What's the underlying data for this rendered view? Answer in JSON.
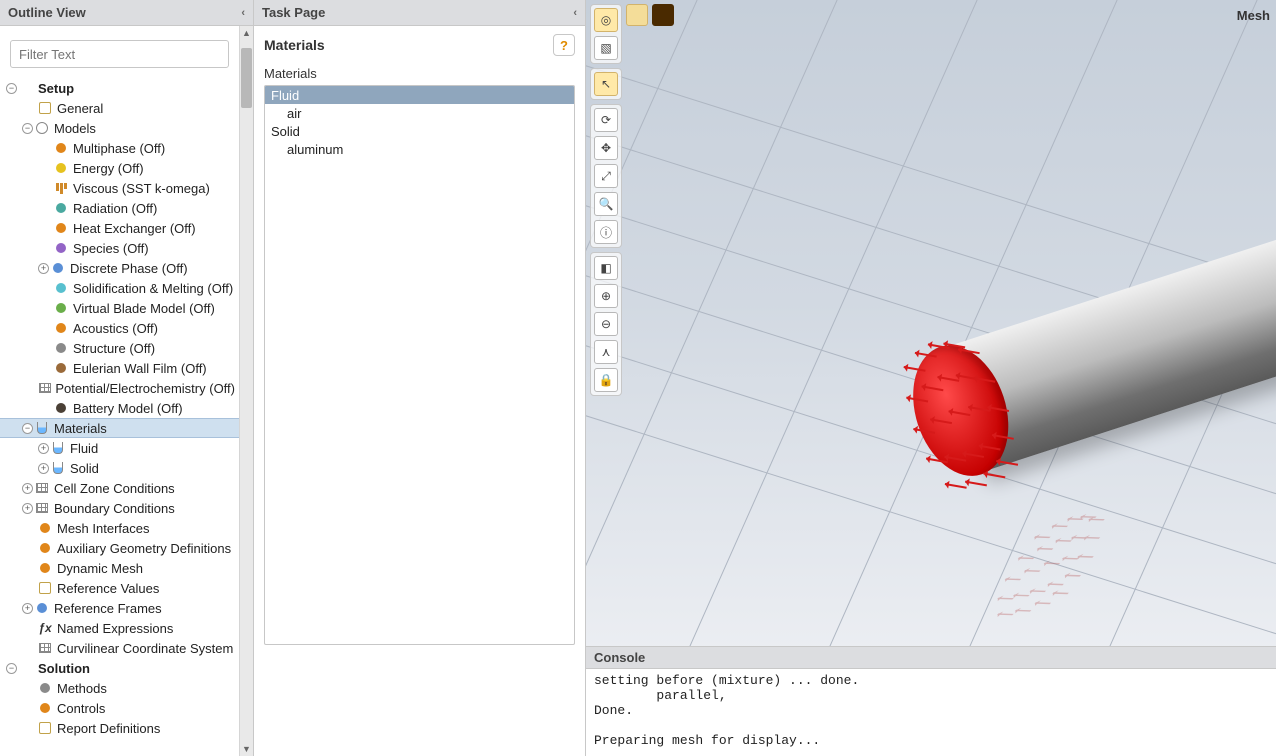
{
  "outline": {
    "title": "Outline View",
    "filter_placeholder": "Filter Text",
    "tree": [
      {
        "label": "Setup",
        "depth": 0,
        "exp": "minus",
        "bold": true,
        "icon": ""
      },
      {
        "label": "General",
        "depth": 1,
        "exp": "none",
        "icon": "sq"
      },
      {
        "label": "Models",
        "depth": 1,
        "exp": "minus",
        "icon": "gear"
      },
      {
        "label": "Multiphase (Off)",
        "depth": 2,
        "exp": "none",
        "icon": "c-orange"
      },
      {
        "label": "Energy (Off)",
        "depth": 2,
        "exp": "none",
        "icon": "c-yellow"
      },
      {
        "label": "Viscous (SST k-omega)",
        "depth": 2,
        "exp": "none",
        "icon": "bars"
      },
      {
        "label": "Radiation (Off)",
        "depth": 2,
        "exp": "none",
        "icon": "c-teal"
      },
      {
        "label": "Heat Exchanger (Off)",
        "depth": 2,
        "exp": "none",
        "icon": "c-orange"
      },
      {
        "label": "Species (Off)",
        "depth": 2,
        "exp": "none",
        "icon": "c-purple"
      },
      {
        "label": "Discrete Phase (Off)",
        "depth": 2,
        "exp": "plus",
        "icon": "c-blue"
      },
      {
        "label": "Solidification & Melting (Off)",
        "depth": 2,
        "exp": "none",
        "icon": "c-cyan"
      },
      {
        "label": "Virtual Blade Model (Off)",
        "depth": 2,
        "exp": "none",
        "icon": "c-green"
      },
      {
        "label": "Acoustics (Off)",
        "depth": 2,
        "exp": "none",
        "icon": "c-orange"
      },
      {
        "label": "Structure (Off)",
        "depth": 2,
        "exp": "none",
        "icon": "c-gray"
      },
      {
        "label": "Eulerian Wall Film (Off)",
        "depth": 2,
        "exp": "none",
        "icon": "c-brown"
      },
      {
        "label": "Potential/Electrochemistry (Off)",
        "depth": 2,
        "exp": "none",
        "icon": "grid"
      },
      {
        "label": "Battery Model (Off)",
        "depth": 2,
        "exp": "none",
        "icon": "c-dark"
      },
      {
        "label": "Materials",
        "depth": 1,
        "exp": "minus",
        "icon": "flask",
        "selected": true
      },
      {
        "label": "Fluid",
        "depth": 2,
        "exp": "plus",
        "icon": "flask"
      },
      {
        "label": "Solid",
        "depth": 2,
        "exp": "plus",
        "icon": "flask"
      },
      {
        "label": "Cell Zone Conditions",
        "depth": 1,
        "exp": "plus",
        "icon": "grid"
      },
      {
        "label": "Boundary Conditions",
        "depth": 1,
        "exp": "plus",
        "icon": "grid"
      },
      {
        "label": "Mesh Interfaces",
        "depth": 1,
        "exp": "none",
        "icon": "c-orange"
      },
      {
        "label": "Auxiliary Geometry Definitions",
        "depth": 1,
        "exp": "none",
        "icon": "c-orange"
      },
      {
        "label": "Dynamic Mesh",
        "depth": 1,
        "exp": "none",
        "icon": "c-orange"
      },
      {
        "label": "Reference Values",
        "depth": 1,
        "exp": "none",
        "icon": "sq"
      },
      {
        "label": "Reference Frames",
        "depth": 1,
        "exp": "plus",
        "icon": "c-blue"
      },
      {
        "label": "Named Expressions",
        "depth": 1,
        "exp": "none",
        "icon": "fx"
      },
      {
        "label": "Curvilinear Coordinate System",
        "depth": 1,
        "exp": "none",
        "icon": "grid"
      },
      {
        "label": "Solution",
        "depth": 0,
        "exp": "minus",
        "bold": true,
        "icon": ""
      },
      {
        "label": "Methods",
        "depth": 1,
        "exp": "none",
        "icon": "c-gray"
      },
      {
        "label": "Controls",
        "depth": 1,
        "exp": "none",
        "icon": "c-orange"
      },
      {
        "label": "Report Definitions",
        "depth": 1,
        "exp": "none",
        "icon": "sq"
      }
    ]
  },
  "taskpage": {
    "title": "Task Page",
    "section_title": "Materials",
    "list_label": "Materials",
    "help": "?",
    "rows": [
      {
        "label": "Fluid",
        "indent": 0,
        "selected": true
      },
      {
        "label": "air",
        "indent": 1
      },
      {
        "label": "Solid",
        "indent": 0
      },
      {
        "label": "aluminum",
        "indent": 1
      }
    ]
  },
  "viewport": {
    "mesh_label": "Mesh",
    "tools": [
      {
        "name": "tool-shaded",
        "glyph": "◎",
        "active": true
      },
      {
        "name": "tool-iso",
        "glyph": "▧"
      },
      {
        "name": "tool-select",
        "glyph": "↖",
        "active": true
      },
      {
        "name": "tool-rotate",
        "glyph": "⟳"
      },
      {
        "name": "tool-pan",
        "glyph": "✥"
      },
      {
        "name": "tool-zoom",
        "glyph": "⤢"
      },
      {
        "name": "tool-zoom-box",
        "glyph": "🔍"
      },
      {
        "name": "tool-info",
        "glyph": "ⓘ"
      },
      {
        "name": "tool-probe",
        "glyph": "◧"
      },
      {
        "name": "tool-zoom-in",
        "glyph": "⊕"
      },
      {
        "name": "tool-zoom-out",
        "glyph": "⊖"
      },
      {
        "name": "tool-axes",
        "glyph": "⋏"
      },
      {
        "name": "tool-lock",
        "glyph": "🔒"
      }
    ]
  },
  "console": {
    "title": "Console",
    "text": "setting before (mixture) ... done.\n        parallel,\nDone.\n\nPreparing mesh for display..."
  },
  "icon_colors": {
    "c-orange": "#e0861a",
    "c-yellow": "#e6c21f",
    "c-teal": "#4aa9a0",
    "c-purple": "#9364c6",
    "c-blue": "#5a8fd6",
    "c-cyan": "#58c0cf",
    "c-green": "#6aae4a",
    "c-gray": "#8a8a8a",
    "c-brown": "#9a6a3a",
    "c-dark": "#4a4036"
  }
}
